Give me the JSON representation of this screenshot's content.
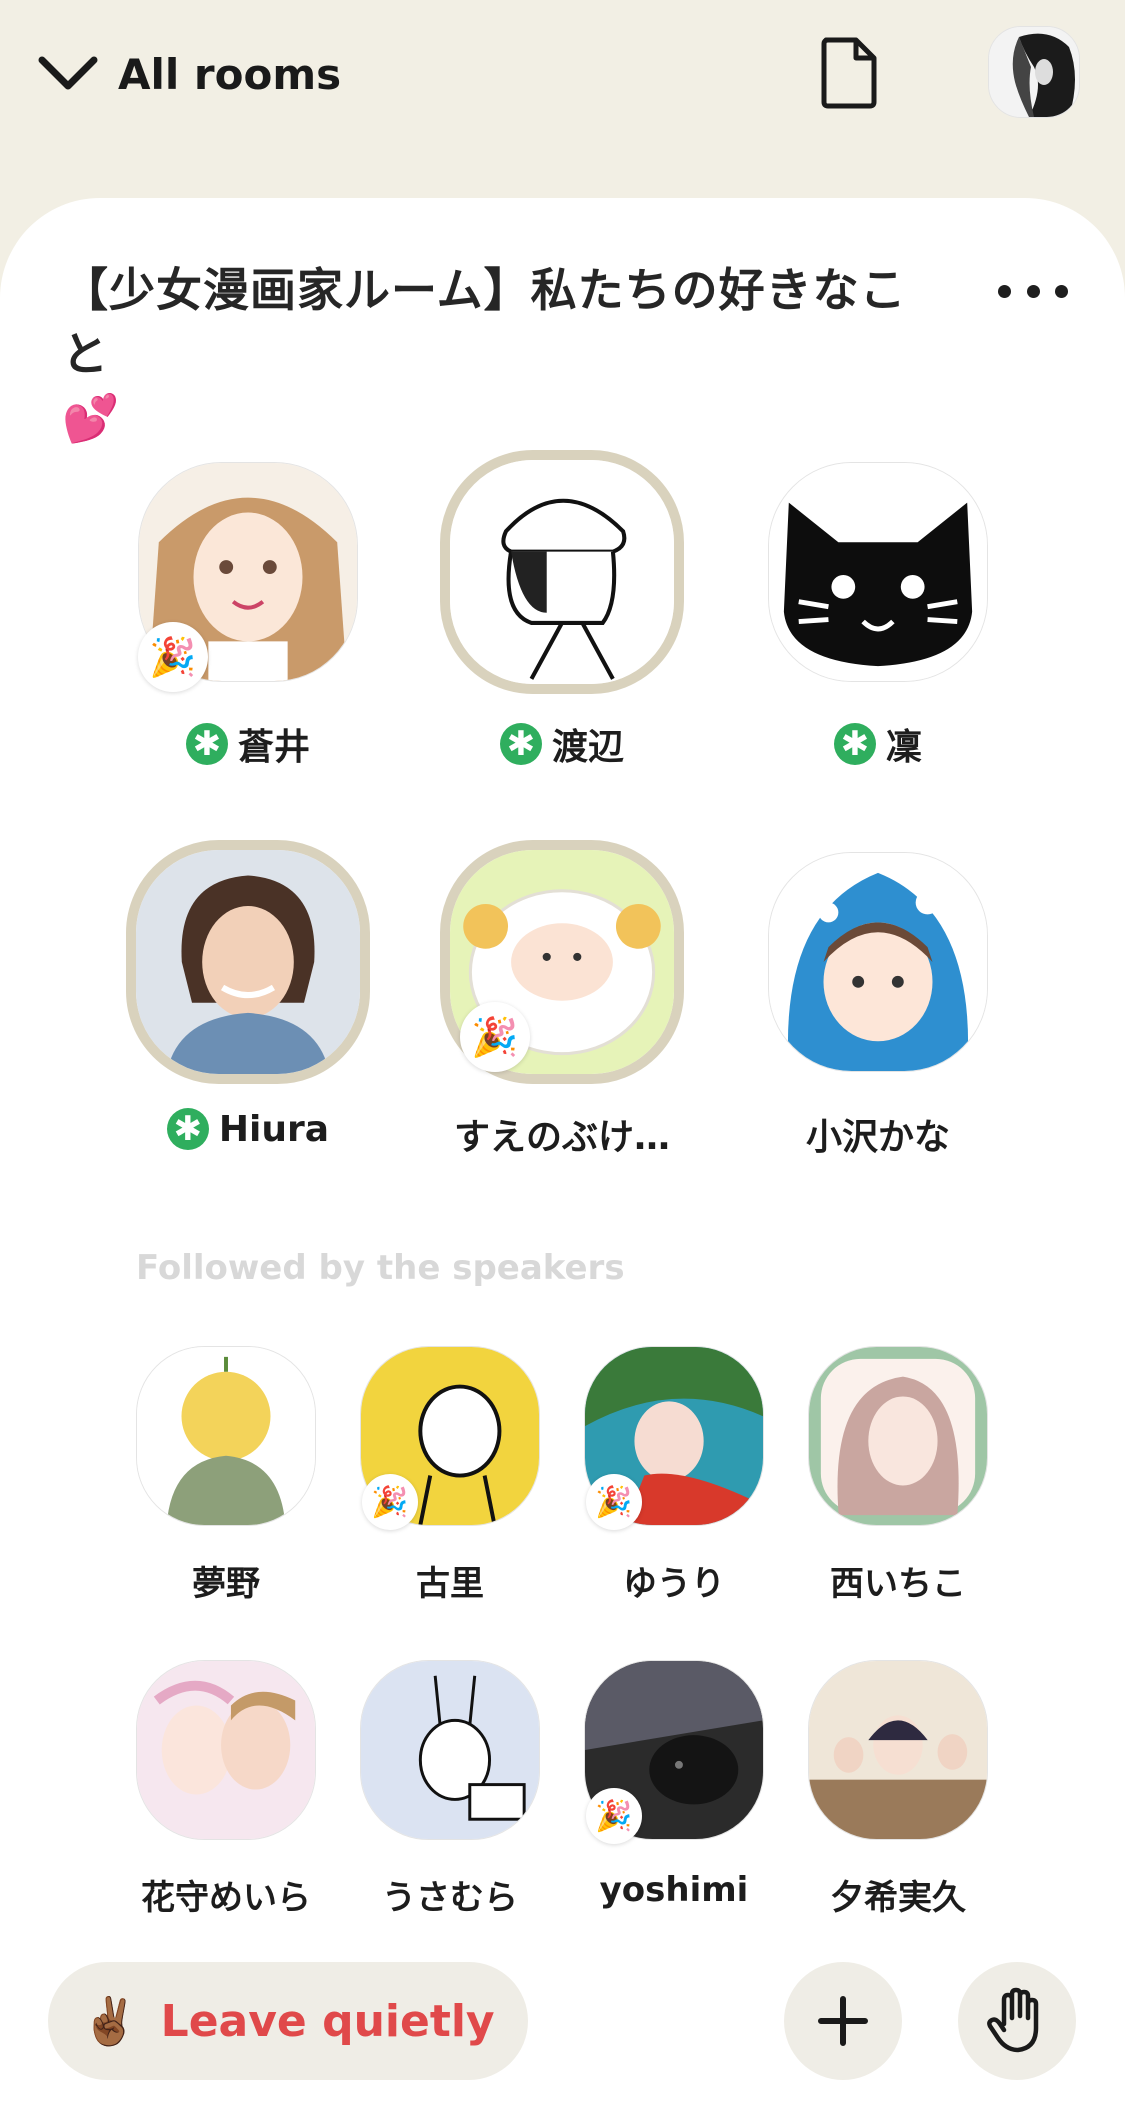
{
  "header": {
    "back_label": "All rooms",
    "icons": {
      "back": "chevron-down-icon",
      "doc": "document-icon",
      "profile": "profile-avatar"
    }
  },
  "room": {
    "title": "【少女漫画家ルーム】私たちの好きなこと",
    "title_emoji": "💕"
  },
  "speakers": [
    {
      "name": "蒼井",
      "moderator": true,
      "badge": "🎉"
    },
    {
      "name": "渡辺",
      "moderator": true,
      "badge": ""
    },
    {
      "name": "凜",
      "moderator": true,
      "badge": ""
    },
    {
      "name": "Hiura",
      "moderator": true,
      "badge": ""
    },
    {
      "name": "すえのぶけ…",
      "moderator": false,
      "badge": "🎉"
    },
    {
      "name": "小沢かな",
      "moderator": false,
      "badge": ""
    }
  ],
  "moderator_symbol": "✱",
  "followed_section_label": "Followed by the speakers",
  "listeners": [
    {
      "name": "夢野",
      "badge": ""
    },
    {
      "name": "古里",
      "badge": "🎉"
    },
    {
      "name": "ゆうり",
      "badge": "🎉"
    },
    {
      "name": "西いちこ",
      "badge": ""
    },
    {
      "name": "花守めいら",
      "badge": ""
    },
    {
      "name": "うさむら",
      "badge": ""
    },
    {
      "name": "yoshimi",
      "badge": "🎉"
    },
    {
      "name": "夕希実久",
      "badge": ""
    }
  ],
  "bottom": {
    "leave_emoji": "✌🏾",
    "leave_label": "Leave quietly",
    "add_icon": "plus-icon",
    "raise_hand_icon": "raise-hand-icon"
  },
  "colors": {
    "accent_red": "#e0494a",
    "moderator_green": "#2fae5e",
    "ring": "#d9d2bd",
    "background": "#f2efe4"
  }
}
